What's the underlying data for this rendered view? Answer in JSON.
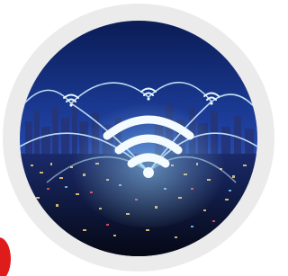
{
  "image": {
    "subject": "wifi-over-night-city",
    "icons": [
      "wifi-main-icon",
      "wifi-small-icon-left",
      "wifi-small-icon-center",
      "wifi-small-icon-right"
    ]
  },
  "colors": {
    "ring": "#ebebeb",
    "sky_top": "#0b1c55",
    "sky_mid": "#1d3f9e",
    "glow": "#bfe8ff",
    "badge": "#e01b1b"
  }
}
